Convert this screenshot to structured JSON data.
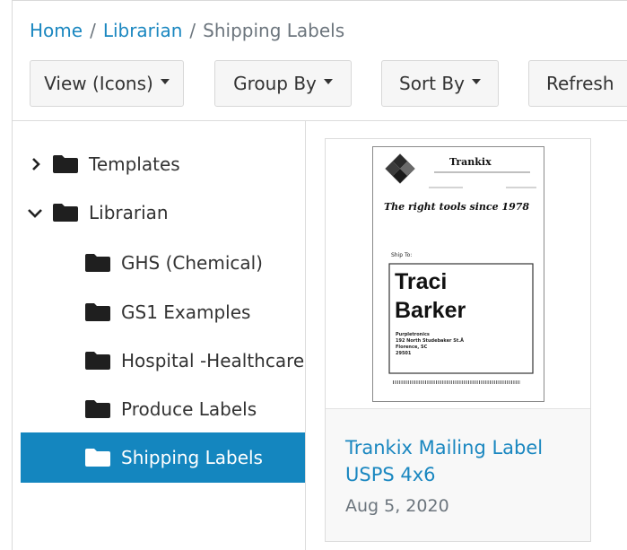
{
  "breadcrumb": [
    {
      "label": "Home",
      "link": true
    },
    {
      "label": "Librarian",
      "link": true
    },
    {
      "label": "Shipping Labels",
      "link": false
    }
  ],
  "toolbar": {
    "view_label": "View (Icons)",
    "group_label": "Group By",
    "sort_label": "Sort By",
    "refresh_label": "Refresh"
  },
  "tree": {
    "templates": "Templates",
    "librarian": "Librarian",
    "ghs": "GHS (Chemical)",
    "gs1": "GS1 Examples",
    "hospital": "Hospital -Healthcare",
    "produce": "Produce Labels",
    "shipping": "Shipping Labels"
  },
  "card": {
    "title": "Trankix Mailing Label USPS 4x6",
    "date": "Aug 5, 2020",
    "preview": {
      "company": "Trankix",
      "tagline": "The right tools since 1978",
      "ship_to": "Ship To:",
      "name_first": "Traci",
      "name_last": "Barker",
      "addr1": "Purpletronics",
      "addr2": "192 North Studebaker St.Å",
      "addr3": "Florence, SC",
      "addr4": "29501"
    }
  },
  "colors": {
    "link": "#1a87c0",
    "selected_bg": "#1486bf",
    "button_bg": "#f6f6f6"
  }
}
